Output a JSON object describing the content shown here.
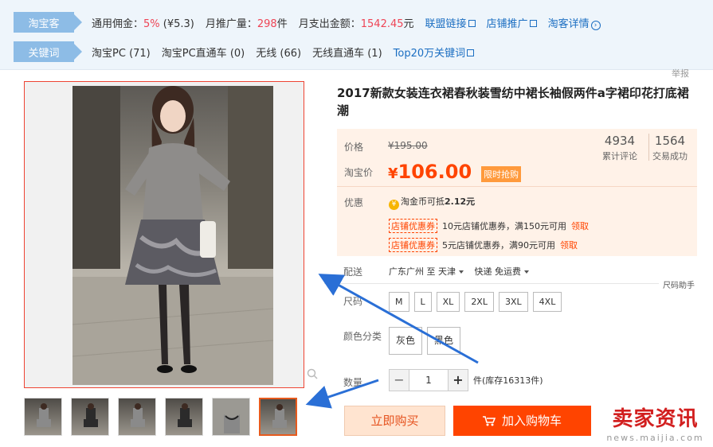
{
  "plugin": {
    "taobaoke": {
      "tag": "淘宝客",
      "commission_label": "通用佣金：",
      "commission_pct": "5%",
      "commission_amt": "(¥5.3)",
      "monthly_promo_label": "月推广量：",
      "monthly_promo_value": "298",
      "monthly_promo_unit": "件",
      "monthly_spend_label": "月支出金额：",
      "monthly_spend_value": "1542.45",
      "monthly_spend_unit": "元",
      "links": [
        "联盟链接",
        "店铺推广",
        "淘客详情"
      ]
    },
    "keywords": {
      "tag": "关键词",
      "items": [
        {
          "label": "淘宝PC",
          "count": "(71)"
        },
        {
          "label": "淘宝PC直通车",
          "count": "(0)"
        },
        {
          "label": "无线",
          "count": "(66)"
        },
        {
          "label": "无线直通车",
          "count": "(1)"
        }
      ],
      "top_link": "Top20万关键词"
    }
  },
  "report": "举报",
  "product": {
    "title": "2017新款女装连衣裙春秋装雪纺中裙长袖假两件a字裙印花打底裙潮",
    "price_label": "价格",
    "price_original": "¥195.00",
    "promo_label": "淘宝价",
    "promo_currency": "¥",
    "promo_price": "106.00",
    "flash_tag": "限时抢购",
    "stats": [
      {
        "value": "4934",
        "label": "累计评论"
      },
      {
        "value": "1564",
        "label": "交易成功"
      }
    ],
    "discount_label": "优惠",
    "coin_text": "淘金币可抵",
    "coin_value": "2.12元",
    "coupons": [
      {
        "tag": "店铺优惠券",
        "text": "10元店铺优惠券，满150元可用",
        "action": "领取"
      },
      {
        "tag": "店铺优惠券",
        "text": "5元店铺优惠券，满90元可用",
        "action": "领取"
      }
    ],
    "delivery_label": "配送",
    "delivery_from": "广东广州 至",
    "delivery_to": "天津",
    "delivery_fee": "快递 免运费",
    "size_help": "尺码助手",
    "size_label": "尺码",
    "sizes": [
      "M",
      "L",
      "XL",
      "2XL",
      "3XL",
      "4XL"
    ],
    "color_label": "颜色分类",
    "colors": [
      "灰色",
      "黑色"
    ],
    "qty_label": "数量",
    "qty_minus": "−",
    "qty_value": "1",
    "qty_plus": "+",
    "stock_text": "件(库存16313件)",
    "buy_now": "立即购买",
    "add_cart": "加入购物车"
  },
  "watermark": {
    "main": "卖家资讯",
    "sub": "news.maijia.com"
  },
  "colors": {
    "accent": "#ff4400",
    "tag_blue": "#8dbce6",
    "link_blue": "#1b6ec2",
    "annotation_blue": "#2a6fd6"
  }
}
